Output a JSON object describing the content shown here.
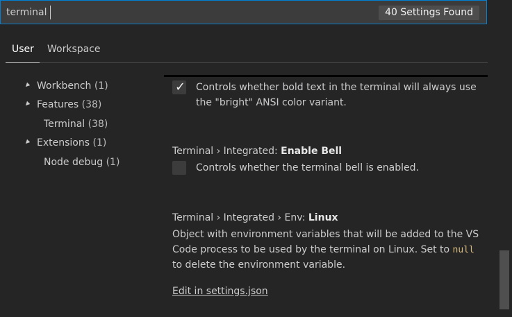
{
  "search": {
    "value": "terminal",
    "results_count": "40 Settings Found"
  },
  "tabs": [
    {
      "label": "User",
      "active": true
    },
    {
      "label": "Workspace",
      "active": false
    }
  ],
  "tree": [
    {
      "label": "Workbench",
      "count": "(1)",
      "expanded": true
    },
    {
      "label": "Features",
      "count": "(38)",
      "expanded": true
    },
    {
      "label": "Terminal",
      "count": "(38)"
    },
    {
      "label": "Extensions",
      "count": "(1)",
      "expanded": true
    },
    {
      "label": "Node debug",
      "count": "(1)"
    }
  ],
  "settings": [
    {
      "checked": true,
      "description_lines": [
        "Controls whether bold text in the terminal will always use",
        "the \"bright\" ANSI color variant."
      ]
    },
    {
      "title_prefix": "Terminal › Integrated: ",
      "title_name": "Enable Bell",
      "checked": false,
      "description": "Controls whether the terminal bell is enabled."
    },
    {
      "title_prefix": "Terminal › Integrated › Env: ",
      "title_name": "Linux",
      "description_lines": [
        "Object with environment variables that will be added to the VS",
        "Code process to be used by the terminal on Linux. Set to ",
        "to delete the environment variable."
      ],
      "code": "null",
      "link": "Edit in settings.json"
    }
  ],
  "colors": {
    "accent_border": "#007fd4",
    "code": "#d7ba7d"
  }
}
